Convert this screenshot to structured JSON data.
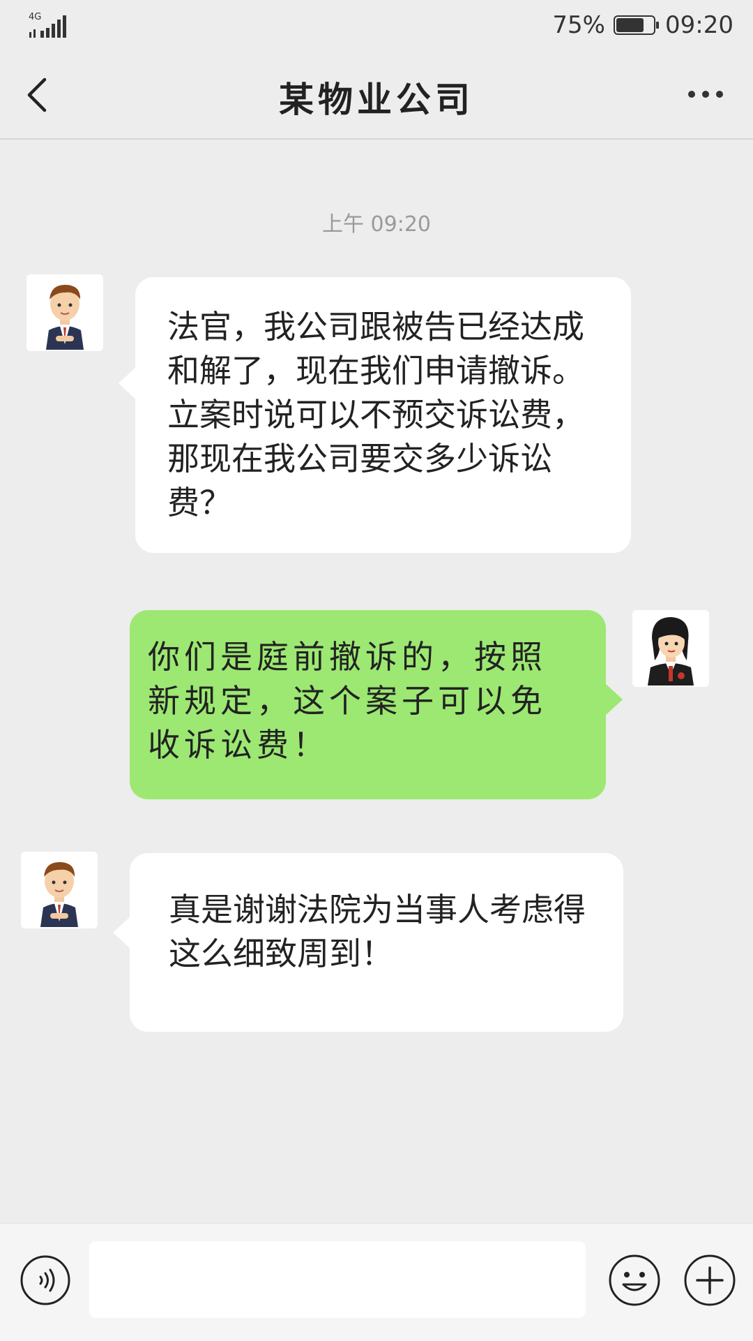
{
  "status_bar": {
    "network": "4G",
    "battery_percent": "75%",
    "battery_level": 0.75,
    "time": "09:20"
  },
  "header": {
    "title": "某物业公司",
    "back_icon": "chevron-left-icon",
    "more_icon": "more-dots-icon"
  },
  "chat": {
    "timestamp": "上午 09:20",
    "messages": [
      {
        "side": "left",
        "sender_avatar": "businessman-avatar",
        "text": "法官，我公司跟被告已经达成和解了，现在我们申请撤诉。立案时说可以不预交诉讼费，那现在我公司要交多少诉讼费？"
      },
      {
        "side": "right",
        "sender_avatar": "judge-avatar",
        "text": "你们是庭前撤诉的，按照新规定，这个案子可以免收诉讼费！"
      },
      {
        "side": "left",
        "sender_avatar": "businessman-avatar",
        "text": "真是谢谢法院为当事人考虑得这么细致周到！"
      }
    ]
  },
  "input_bar": {
    "value": "",
    "voice_icon": "voice-icon",
    "emoji_icon": "emoji-icon",
    "plus_icon": "plus-icon"
  },
  "colors": {
    "background": "#ededed",
    "bubble_self": "#9ce872",
    "bubble_other": "#ffffff"
  }
}
